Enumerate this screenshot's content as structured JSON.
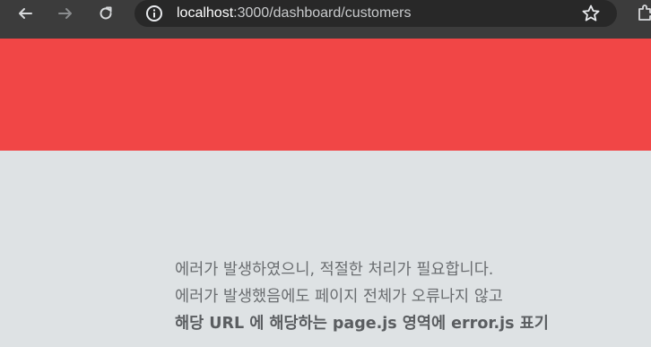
{
  "browser": {
    "url_host": "localhost",
    "url_path": ":3000/dashboard/customers",
    "icons": {
      "back": "arrow-left-icon",
      "forward": "arrow-right-icon",
      "reload": "reload-icon",
      "site_info": "info-icon",
      "bookmark": "star-icon",
      "extensions": "puzzle-icon"
    }
  },
  "page": {
    "banner_color": "#f14646",
    "background_color": "#dee2e4",
    "message_lines": [
      "에러가 발생하였으니, 적절한 처리가 필요합니다.",
      "에러가 발생했음에도 페이지 전체가 오류나지 않고",
      "해당 URL 에 해당하는 page.js 영역에 error.js 표기"
    ]
  }
}
